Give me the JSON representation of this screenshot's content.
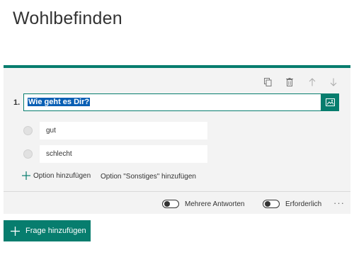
{
  "page": {
    "title": "Wohlbefinden"
  },
  "question": {
    "number": "1.",
    "text": "Wie geht es Dir?",
    "options": [
      {
        "label": "gut"
      },
      {
        "label": "schlecht"
      }
    ],
    "add_option_label": "Option hinzufügen",
    "add_other_label": "Option \"Sonstiges\" hinzufügen",
    "toggles": {
      "multiple_answers_label": "Mehrere Antworten",
      "multiple_answers_on": false,
      "required_label": "Erforderlich",
      "required_on": false
    },
    "more_label": "···"
  },
  "add_question_label": "Frage hinzufügen",
  "colors": {
    "accent": "#077d6e",
    "card_bg": "#f3f3f3",
    "selection": "#0a5fb4"
  },
  "icons": [
    "copy-icon",
    "delete-icon",
    "move-up-icon",
    "move-down-icon",
    "image-icon",
    "plus-icon",
    "more-icon"
  ]
}
